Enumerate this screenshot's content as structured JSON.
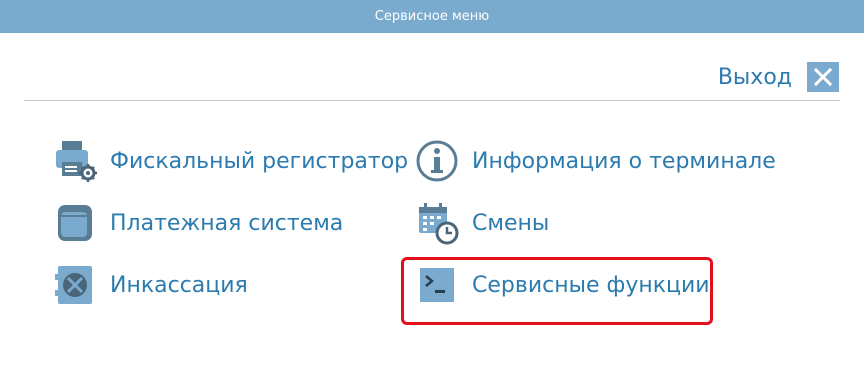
{
  "window": {
    "title": "Сервисное меню"
  },
  "header": {
    "exit_label": "Выход",
    "exit_icon": "close-icon"
  },
  "menu": {
    "left": [
      {
        "label": "Фискальный регистратор",
        "icon": "fiscal-printer-icon"
      },
      {
        "label": "Платежная система",
        "icon": "wallet-icon"
      },
      {
        "label": "Инкассация",
        "icon": "safe-icon"
      }
    ],
    "right": [
      {
        "label": "Информация о терминале",
        "icon": "info-icon"
      },
      {
        "label": "Смены",
        "icon": "calendar-clock-icon"
      },
      {
        "label": "Сервисные функции",
        "icon": "terminal-icon",
        "highlighted": true
      }
    ]
  },
  "colors": {
    "accent": "#7aaacd",
    "text": "#2b7bb0",
    "icon": "#5a7d96",
    "highlight": "#e2101a"
  }
}
